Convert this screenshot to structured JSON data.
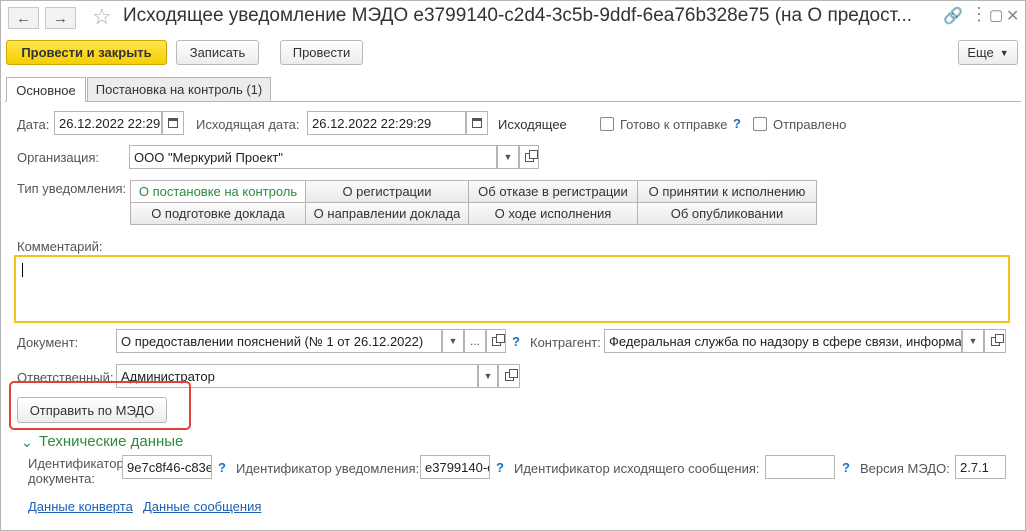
{
  "window": {
    "title": "Исходящее уведомление МЭДО e3799140-c2d4-3c5b-9ddf-6ea76b328e75 (на О предост..."
  },
  "toolbar": {
    "post_close": "Провести и закрыть",
    "save": "Записать",
    "post": "Провести",
    "more": "Еще"
  },
  "tabs": [
    {
      "label": "Основное",
      "active": true
    },
    {
      "label": "Постановка на контроль (1)",
      "active": false
    }
  ],
  "header": {
    "date_label": "Дата:",
    "date_value": "26.12.2022 22:29:",
    "out_date_label": "Исходящая дата:",
    "out_date_value": "26.12.2022 22:29:29",
    "direction": "Исходящее",
    "ready_label": "Готово к отправке",
    "sent_label": "Отправлено"
  },
  "org": {
    "label": "Организация:",
    "value": "ООО \"Меркурий Проект\""
  },
  "notif_type": {
    "label": "Тип уведомления:",
    "options": [
      "О постановке на контроль",
      "О регистрации",
      "Об отказе в регистрации",
      "О принятии к исполнению",
      "О подготовке доклада",
      "О направлении доклада",
      "О ходе исполнения",
      "Об опубликовании"
    ],
    "selected": "О постановке на контроль"
  },
  "comment": {
    "label": "Комментарий:",
    "value": ""
  },
  "document": {
    "label": "Документ:",
    "value": "О предоставлении пояснений (№ 1 от 26.12.2022)"
  },
  "counterparty": {
    "label": "Контрагент:",
    "value": "Федеральная служба по надзору в сфере связи, информац"
  },
  "responsible": {
    "label": "Ответственный:",
    "value": "Администратор"
  },
  "send_button": "Отправить по МЭДО",
  "tech": {
    "section_title": "Технические данные",
    "doc_id_label_1": "Идентификатор",
    "doc_id_label_2": "документа:",
    "doc_id_value": "9e7c8f46-c83e",
    "notif_id_label": "Идентификатор уведомления:",
    "notif_id_value": "e3799140-c",
    "out_msg_label": "Идентификатор исходящего сообщения:",
    "out_msg_value": "",
    "version_label": "Версия МЭДО:",
    "version_value": "2.7.1"
  },
  "links": {
    "envelope": "Данные конверта",
    "message": "Данные сообщения"
  },
  "colors": {
    "accent_yellow": "#f5cf00",
    "green_section": "#2e8b3e",
    "link_blue": "#1a5fb4",
    "highlight_red": "#e0413a",
    "comment_border": "#f0c419"
  }
}
